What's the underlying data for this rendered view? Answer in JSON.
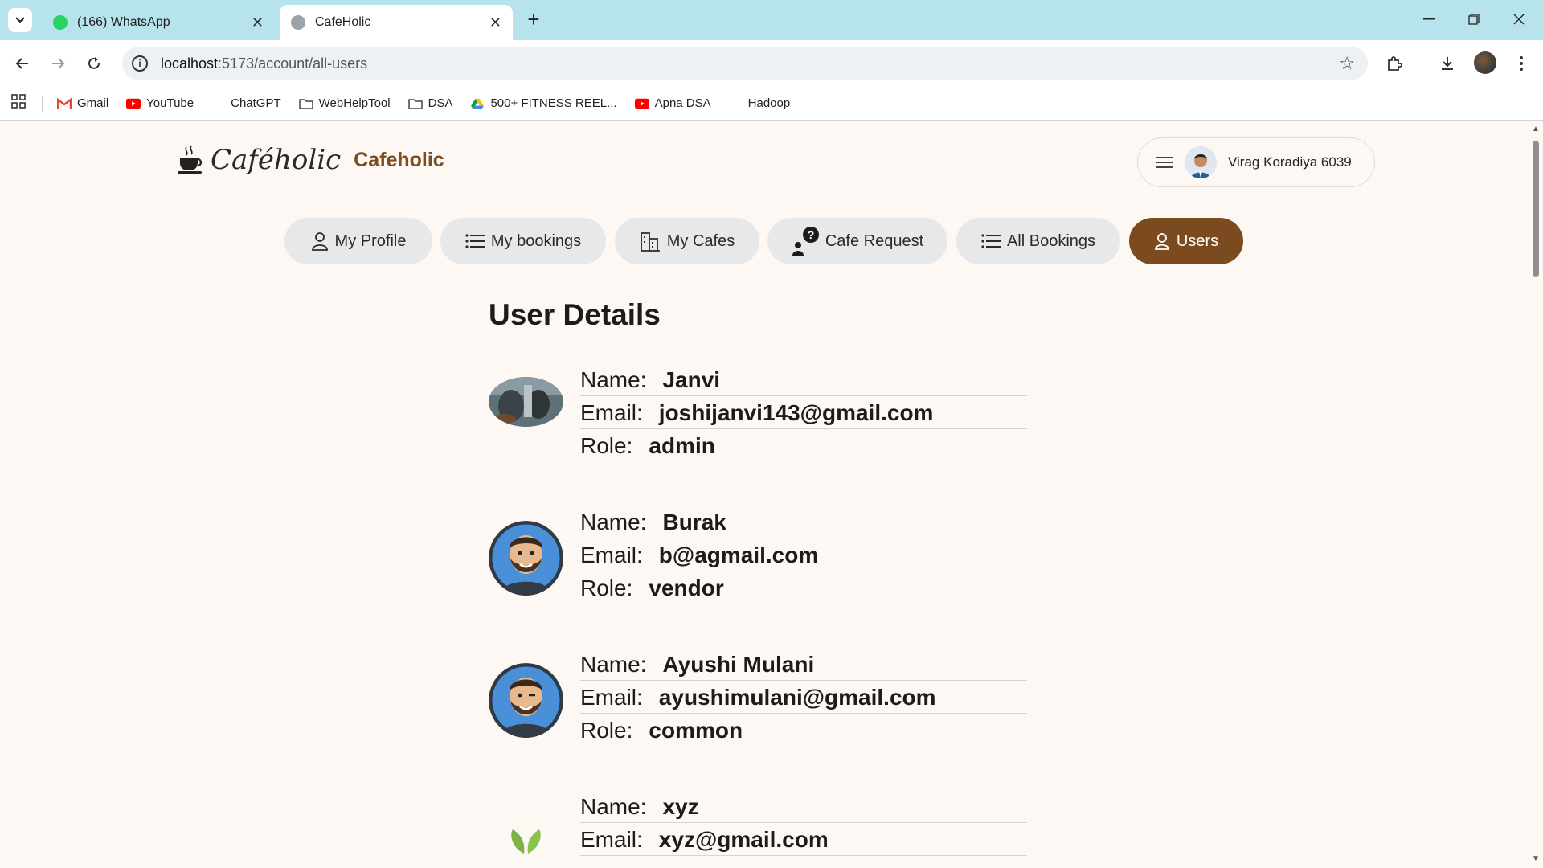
{
  "browser": {
    "tabs": [
      {
        "title": "(166) WhatsApp",
        "active": false
      },
      {
        "title": "CafeHolic",
        "active": true
      }
    ],
    "url_host": "localhost",
    "url_path": ":5173/account/all-users",
    "bookmarks": [
      "Gmail",
      "YouTube",
      "ChatGPT",
      "WebHelpTool",
      "DSA",
      "500+ FITNESS REEL...",
      "Apna DSA",
      "Hadoop"
    ]
  },
  "header": {
    "logo_script": "Caféholic",
    "brand": "Cafeholic",
    "user_name": "Virag Koradiya 6039"
  },
  "nav": [
    {
      "label": "My Profile",
      "icon": "person-icon",
      "active": false
    },
    {
      "label": "My bookings",
      "icon": "list-icon",
      "active": false
    },
    {
      "label": "My Cafes",
      "icon": "building-icon",
      "active": false
    },
    {
      "label": "Cafe Request",
      "icon": "question-person-icon",
      "active": false
    },
    {
      "label": "All Bookings",
      "icon": "list-icon",
      "active": false
    },
    {
      "label": "Users",
      "icon": "person-icon",
      "active": true
    }
  ],
  "main": {
    "title": "User Details",
    "labels": {
      "name": "Name:",
      "email": "Email:",
      "role": "Role:"
    },
    "users": [
      {
        "name": "Janvi",
        "email": "joshijanvi143@gmail.com",
        "role": "admin",
        "avatar": "photo-avatar"
      },
      {
        "name": "Burak",
        "email": "b@agmail.com",
        "role": "vendor",
        "avatar": "cartoon-man-avatar"
      },
      {
        "name": "Ayushi Mulani",
        "email": "ayushimulani@gmail.com",
        "role": "common",
        "avatar": "cartoon-man-avatar"
      },
      {
        "name": "xyz",
        "email": "xyz@gmail.com",
        "role": "",
        "avatar": "leaf-avatar"
      }
    ]
  },
  "colors": {
    "accent": "#7b4a1e",
    "page_bg": "#fdf8f4",
    "tabbar_bg": "#b6e3ec",
    "nav_bg": "#e7e8ea"
  }
}
